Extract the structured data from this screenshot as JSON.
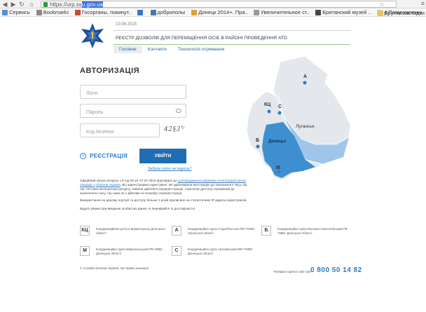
{
  "browser": {
    "url_prefix": "https://urp.ss",
    "url_selected": "u.gov.ua",
    "bookmarks": [
      {
        "label": "Сервисы",
        "color": "#5b8ed6"
      },
      {
        "label": "Bookmarks",
        "color": "#888888"
      },
      {
        "label": "Госорганы, покинут...",
        "color": "#c94a3a"
      },
      {
        "label": "",
        "color": "#3a73c9"
      },
      {
        "label": "добропольє",
        "color": "#4a76a8"
      },
      {
        "label": "Донецк 2014+. Пра...",
        "color": "#d9a23c"
      },
      {
        "label": "Увеличительное ст...",
        "color": "#999999"
      },
      {
        "label": "Британский музей ...",
        "color": "#444444"
      },
      {
        "label": "4 Повідомлення",
        "color": "#c9c9c9"
      }
    ],
    "other_bookmarks": "Другие закладки"
  },
  "header": {
    "date": "10.08.2015",
    "title": "РЕЄСТР ДОЗВОЛІВ ДЛЯ ПЕРЕМІЩЕННЯ ОСІБ В РАЙОНІ ПРОВЕДЕННЯ АТО",
    "menu": [
      "Головне",
      "Контакти",
      "Технологія отримання"
    ]
  },
  "auth": {
    "title": "АВТОРИЗАЦІЯ",
    "login_placeholder": "Логін",
    "password_placeholder": "Пароль",
    "captcha_placeholder": "Код безпеки",
    "captcha_text": "42§3",
    "captcha_reload": "↻",
    "register": "РЕЄСТРАЦІЯ",
    "login_button": "УВІЙТИ",
    "forgot": "Забули логін чи пароль?"
  },
  "map": {
    "labels": {
      "a": "А",
      "kts": "КЦ",
      "s": "С",
      "luhansk": "Луганськ",
      "b": "Б",
      "donetsk": "Донецьк",
      "m": "М"
    },
    "colors": {
      "luhansk": "#9fc6e8",
      "donetsk": "#3e8fd0",
      "outline": "#e4e8ec"
    }
  },
  "info": {
    "p1_a": "Офіційний запуск ресурсу з 9 год 00 хв. 07.07.2015 відповідно до",
    "p1_link1": "розпорядження керівника Антитерористичної операції з",
    "p1_b": "",
    "p1_link2": "оборони України",
    "p1_c": ". Всі зареєстровані користувачі, які здійснювали реєстрацію до зазначеного часу, під час тестової експлуатації ресурсу, повинні здійснити перереєстрацію. Агрегатор доступу, отриманий до зазначеного часу, так само не є дійсним та потребує перереєстрації.",
    "p2": "Використання на даному порталі та доступу більше 1 рохів прописано на статистичних IP-адреса користувачів.",
    "p3": "Будьте уважні при введенні особистих даних та перевіряйте їх достовірність!"
  },
  "legend": [
    {
      "code": "КЦ",
      "text": "Координаційний центр в Краматорську Донецької області"
    },
    {
      "code": "А",
      "text": "Координаційна група Старобільської РВ ГУМВС Луганської області"
    },
    {
      "code": "Б",
      "text": "Координаційна група Волново-Новоселівський РВ УМВС Донецької області"
    },
    {
      "code": "М",
      "text": "Координаційна група Маріупольський РВ УМВС Донецької області"
    },
    {
      "code": "С",
      "text": "Координаційна група Артемівський МВ ГУМВС Донецької області"
    }
  ],
  "footer": {
    "copyright": "© Служба безпеки України. Всі права захищені",
    "hotline_label": "Телефон гарячої лінії СБУ",
    "hotline": "0 800 50 14 82"
  }
}
